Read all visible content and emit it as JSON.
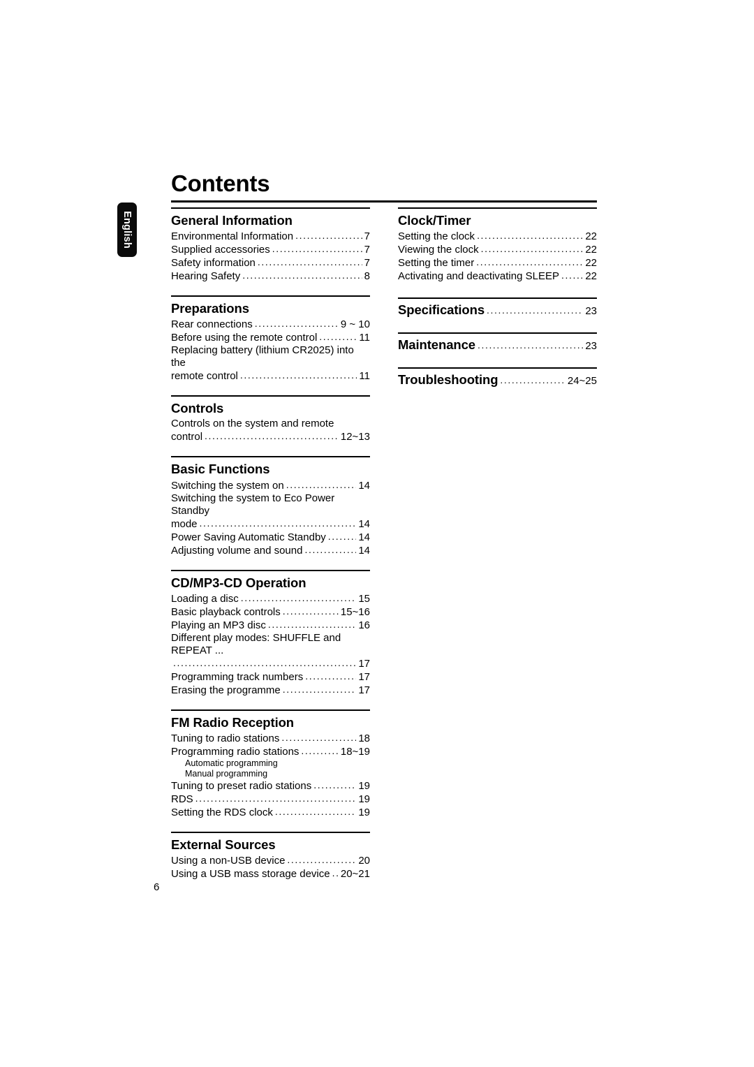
{
  "page": {
    "title": "Contents",
    "folio": "6",
    "language_tab": "English",
    "accent_color": "#000000",
    "background_color": "#ffffff"
  },
  "columns": {
    "left": [
      {
        "heading": "General Information",
        "entries": [
          {
            "text": "Environmental Information",
            "page": "7"
          },
          {
            "text": "Supplied accessories",
            "page": "7"
          },
          {
            "text": "Safety information",
            "page": "7"
          },
          {
            "text": "Hearing Safety",
            "page": "8"
          }
        ]
      },
      {
        "heading": "Preparations",
        "entries": [
          {
            "text": "Rear connections",
            "page": "9 ~ 10"
          },
          {
            "text": "Before using the remote control",
            "page": "11"
          },
          {
            "text": "Replacing battery (lithium CR2025) into the",
            "wrap": "first"
          },
          {
            "text": "remote control",
            "page": "11"
          }
        ]
      },
      {
        "heading": "Controls",
        "entries": [
          {
            "text": "Controls on the system and remote",
            "wrap": "first"
          },
          {
            "text": "control",
            "page": "12~13"
          }
        ]
      },
      {
        "heading": "Basic Functions",
        "entries": [
          {
            "text": "Switching the system on",
            "page": "14"
          },
          {
            "text": "Switching the system to Eco Power Standby",
            "wrap": "first"
          },
          {
            "text": "mode",
            "page": "14"
          },
          {
            "text": "Power Saving Automatic Standby",
            "page": "14"
          },
          {
            "text": "Adjusting volume and sound",
            "page": "14"
          }
        ]
      },
      {
        "heading": "CD/MP3-CD Operation",
        "entries": [
          {
            "text": "Loading a disc",
            "page": "15"
          },
          {
            "text": "Basic playback controls",
            "page": "15~16"
          },
          {
            "text": "Playing an MP3 disc",
            "page": "16"
          },
          {
            "text": "Different play modes: SHUFFLE and REPEAT ...",
            "wrap": "first"
          },
          {
            "text": "",
            "page": "17",
            "cont": true
          },
          {
            "text": "Programming track numbers",
            "page": "17"
          },
          {
            "text": "Erasing the programme",
            "page": "17"
          }
        ]
      },
      {
        "heading": "FM Radio Reception",
        "entries": [
          {
            "text": "Tuning to radio stations",
            "page": "18"
          },
          {
            "text": "Programming radio stations",
            "page": "18~19"
          },
          {
            "text": "Automatic programming",
            "sub": true
          },
          {
            "text": "Manual programming",
            "sub": true
          },
          {
            "text": "Tuning to preset radio stations",
            "page": "19"
          },
          {
            "text": "RDS",
            "page": "19"
          },
          {
            "text": "Setting the RDS clock",
            "page": "19"
          }
        ]
      },
      {
        "heading": "External Sources",
        "entries": [
          {
            "text": "Using a non-USB device",
            "page": "20"
          },
          {
            "text": "Using a USB mass storage device",
            "page": "20~21"
          }
        ]
      }
    ],
    "right": [
      {
        "heading": "Clock/Timer",
        "entries": [
          {
            "text": "Setting the clock",
            "page": "22"
          },
          {
            "text": "Viewing the clock",
            "page": "22"
          },
          {
            "text": "Setting the timer",
            "page": "22"
          },
          {
            "text": "Activating and deactivating SLEEP",
            "page": "22"
          }
        ]
      },
      {
        "heading": "Specifications",
        "heading_page": "23",
        "entries": []
      },
      {
        "heading": "Maintenance",
        "heading_page": "23",
        "entries": []
      },
      {
        "heading": "Troubleshooting",
        "heading_page": "24~25",
        "entries": []
      }
    ]
  }
}
